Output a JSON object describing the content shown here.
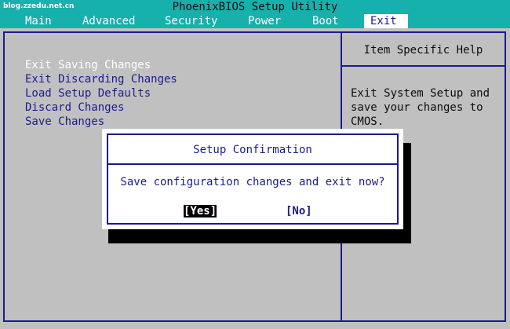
{
  "watermark": "blog.zzedu.net.cn",
  "app_title": "PhoenixBIOS Setup Utility",
  "menu": [
    {
      "label": "Main"
    },
    {
      "label": "Advanced"
    },
    {
      "label": "Security"
    },
    {
      "label": "Power"
    },
    {
      "label": "Boot"
    },
    {
      "label": "Exit",
      "active": true
    }
  ],
  "exit_menu": [
    {
      "label": "Exit Saving Changes",
      "selected": true
    },
    {
      "label": "Exit Discarding Changes"
    },
    {
      "label": "Load Setup Defaults"
    },
    {
      "label": "Discard Changes"
    },
    {
      "label": "Save Changes"
    }
  ],
  "help": {
    "title": "Item Specific Help",
    "lines": [
      "Exit System Setup and",
      "save your changes to",
      "CMOS."
    ]
  },
  "dialog": {
    "title": "Setup Confirmation",
    "message": "Save configuration changes and exit now?",
    "yes_label": "[Yes]",
    "no_label": "[No]"
  },
  "colors": {
    "bar_teal": "#17b1ad",
    "panel_gray": "#c0c0c0",
    "bios_blue": "#1b1b8f",
    "highlight_white": "#ffffff"
  }
}
